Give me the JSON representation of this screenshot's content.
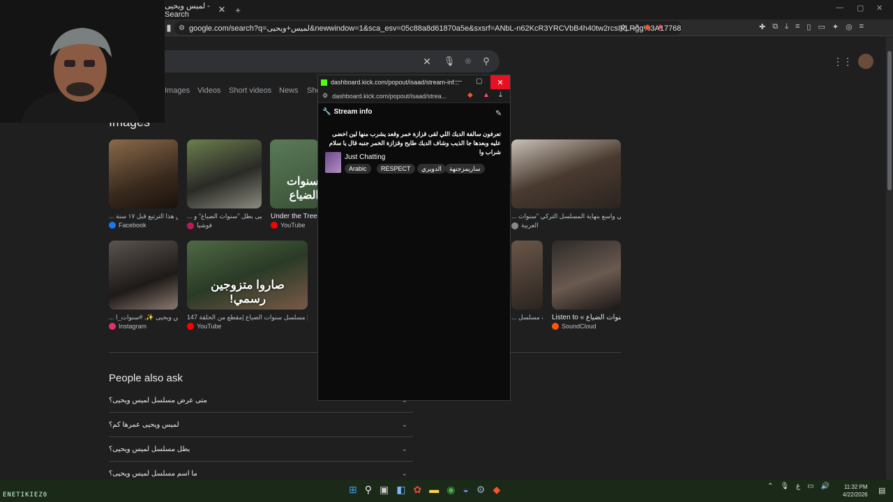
{
  "browser": {
    "tab_title": "لميس ويحيى - Search",
    "new_tab": "+",
    "url": "google.com/search?q=لميس+ويحيى&newwindow=1&sca_esv=05c88a8d61870a5e&sxsrf=ANbL-n62KcR3YRCVbB4h40tw2rcsIPLRgg%3A17768..."
  },
  "google": {
    "tabs": [
      "Images",
      "Videos",
      "Short videos",
      "News",
      "Sho"
    ],
    "images_heading": "Images",
    "results": [
      {
        "caption": "... نص هذا الترتيع قبل ١٧ سنة",
        "source": "Facebook",
        "source_color": "#1877f2"
      },
      {
        "caption": "... يحيى بطل \"سنوات الضياع\" و",
        "source": "فوشيا",
        "source_color": "#c2185b"
      },
      {
        "caption": "Under the Trees",
        "source": "YouTube",
        "source_color": "#ff0000"
      },
      {
        "caption": "... صام عربي واسع بنهاية المسلسل التركي \"سنوات",
        "source": "العربية",
        "source_color": "#888888"
      },
      {
        "caption": "... لميس ويحيى ✨, #سنوات_ا",
        "source": "Instagram",
        "source_color": "#e1306c"
      },
      {
        "caption": "147 مسلسل سنوات الضياع |مقطع من الحلقة | Ihlam...",
        "source": "YouTube",
        "source_color": "#ff0000"
      },
      {
        "caption": "... لخدمة مسلسل",
        "source": "",
        "source_color": "#888888"
      },
      {
        "caption": "Listen to « سنوات الضياع ...",
        "source": "SoundCloud",
        "source_color": "#ff5500"
      }
    ],
    "thumb_text": "صاروا متزوجين رسمي!",
    "thumb_text2": "سنوات الضياع",
    "people_also_ask": "People also ask",
    "questions": [
      "متى عرض مسلسل لميس ويحيى؟",
      "لميس ويحيى عمرها كم؟",
      "بطل مسلسل لميس ويحيى؟",
      "ما اسم مسلسل لميس ويحيى؟"
    ]
  },
  "popout": {
    "title": "dashboard.kick.com/popout/isaad/stream-inf...",
    "url": "dashboard.kick.com/popout/isaad/strea...",
    "heading": "Stream info",
    "description": "تعرفون سالفة الديك اللي لقى قزازة خمر وقعد يشرب منها لين اخضى عليه وبعدها جا الذيب وشاف الديك طايح وقزازة الخمر جنبه قال يا سلام شراب وا",
    "category": "Just Chatting",
    "tags": [
      "Arabic",
      "RESPECT",
      "الدويري",
      "ساريمزجنهة"
    ]
  },
  "taskbar": {
    "time": "11:32 PM",
    "date": "4/22/2026",
    "lang": "ع",
    "watermark": "ENETIKIEZ0"
  }
}
